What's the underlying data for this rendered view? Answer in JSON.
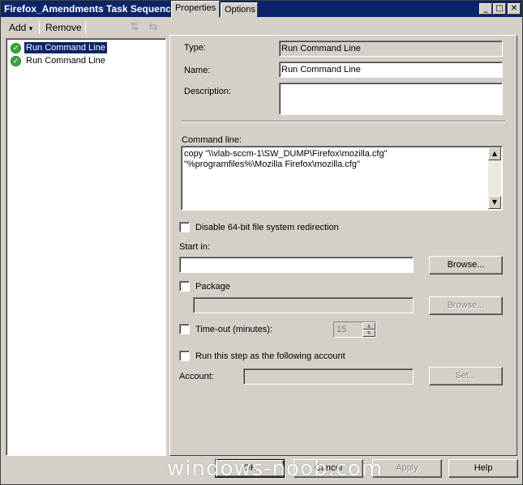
{
  "window": {
    "title": "Firefox_Amendments Task Sequence Editor",
    "minimize_glyph": "_",
    "maximize_glyph": "□",
    "close_glyph": "✕"
  },
  "toolbar": {
    "add_label": "Add",
    "add_arrow": "▾",
    "remove_label": "Remove",
    "move_up_icon": "⇅",
    "move_down_icon": "⇆"
  },
  "tree": {
    "items": [
      {
        "label": "Run Command Line",
        "selected": true
      },
      {
        "label": "Run Command Line",
        "selected": false
      }
    ]
  },
  "tabs": [
    {
      "label": "Properties"
    },
    {
      "label": "Options"
    }
  ],
  "properties": {
    "type_label": "Type:",
    "type_value": "Run Command Line",
    "name_label": "Name:",
    "name_value": "Run Command Line",
    "description_label": "Description:",
    "description_value": "",
    "command_line_label": "Command line:",
    "command_line_value": "copy \"\\\\vlab-sccm-1\\SW_DUMP\\Firefox\\mozilla.cfg\" \"%programfiles%\\Mozilla Firefox\\mozilla.cfg\"",
    "disable_64bit_label": "Disable 64-bit file system redirection",
    "start_in_label": "Start in:",
    "start_in_value": "",
    "browse_label": "Browse...",
    "package_label": "Package",
    "package_value": "",
    "package_browse_label": "Browse...",
    "timeout_label": "Time-out (minutes):",
    "timeout_value": "15",
    "run_as_label": "Run this step as the following account",
    "account_label": "Account:",
    "account_value": "",
    "set_label": "Set..."
  },
  "buttons": {
    "ok": "OK",
    "cancel": "Cancel",
    "apply": "Apply",
    "help": "Help"
  },
  "watermark": "windows-noob.com"
}
